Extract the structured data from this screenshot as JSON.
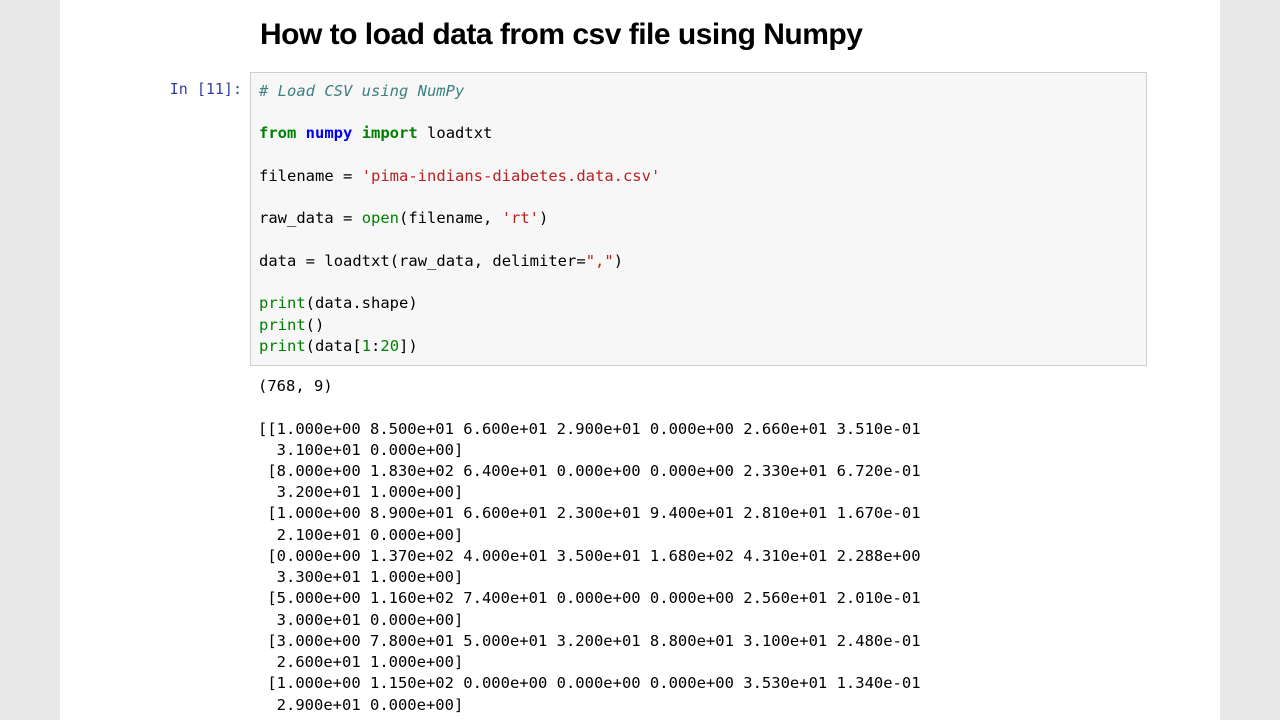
{
  "heading": "How to load data from csv file using Numpy",
  "prompt": "In [11]:",
  "code": {
    "comment": "# Load CSV using NumPy",
    "kw_from": "from",
    "mod_numpy": "numpy",
    "kw_import": "import",
    "fn_loadtxt": "loadtxt",
    "var_filename": "filename",
    "eq": "=",
    "str_filename": "'pima-indians-diabetes.data.csv'",
    "var_rawdata": "raw_data",
    "fn_open": "open",
    "str_rt": "'rt'",
    "var_data": "data",
    "fn_loadtxt2": "loadtxt",
    "arg_delim": "delimiter",
    "str_comma": "\",\"",
    "fn_print": "print",
    "attr_shape": "data.shape",
    "slice": "data[",
    "num1": "1",
    "colon": ":",
    "num20": "20",
    "close": "])"
  },
  "output": "(768, 9)\n\n[[1.000e+00 8.500e+01 6.600e+01 2.900e+01 0.000e+00 2.660e+01 3.510e-01\n  3.100e+01 0.000e+00]\n [8.000e+00 1.830e+02 6.400e+01 0.000e+00 0.000e+00 2.330e+01 6.720e-01\n  3.200e+01 1.000e+00]\n [1.000e+00 8.900e+01 6.600e+01 2.300e+01 9.400e+01 2.810e+01 1.670e-01\n  2.100e+01 0.000e+00]\n [0.000e+00 1.370e+02 4.000e+01 3.500e+01 1.680e+02 4.310e+01 2.288e+00\n  3.300e+01 1.000e+00]\n [5.000e+00 1.160e+02 7.400e+01 0.000e+00 0.000e+00 2.560e+01 2.010e-01\n  3.000e+01 0.000e+00]\n [3.000e+00 7.800e+01 5.000e+01 3.200e+01 8.800e+01 3.100e+01 2.480e-01\n  2.600e+01 1.000e+00]\n [1.000e+00 1.150e+02 0.000e+00 0.000e+00 0.000e+00 3.530e+01 1.340e-01\n  2.900e+01 0.000e+00]"
}
